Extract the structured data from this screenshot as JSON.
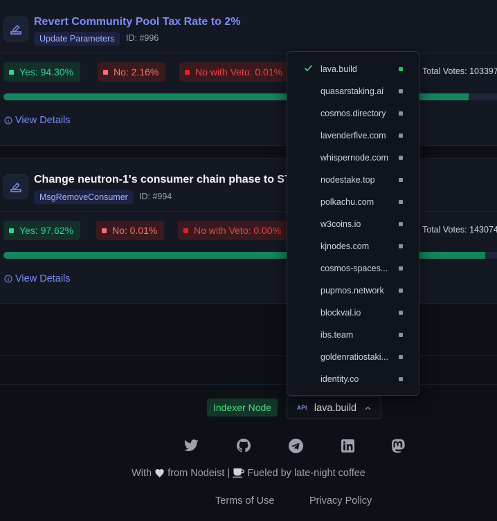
{
  "proposals": [
    {
      "title": "Revert Community Pool Tax Rate to 2%",
      "title_color": "#818cf8",
      "type": "Update Parameters",
      "id": "ID: #996",
      "yes": "Yes: 94.30%",
      "no": "No: 2.16%",
      "veto": "No with Veto: 0.01%",
      "total": "Total Votes: 103397",
      "yes_fraction": 0.943,
      "details": "View Details"
    },
    {
      "title": "Change neutron-1's consumer chain phase to STOP",
      "title_color": "#f3f4f6",
      "type": "MsgRemoveConsumer",
      "id": "ID: #994",
      "yes": "Yes: 97.62%",
      "no": "No: 0.01%",
      "veto": "No with Veto: 0.00%",
      "total": "Total Votes: 143074",
      "yes_fraction": 0.9762,
      "details": "View Details"
    }
  ],
  "api_dropdown": {
    "items": [
      {
        "label": "lava.build",
        "selected": true
      },
      {
        "label": "quasarstaking.ai",
        "selected": false
      },
      {
        "label": "cosmos.directory",
        "selected": false
      },
      {
        "label": "lavenderfive.com",
        "selected": false
      },
      {
        "label": "whispernode.com",
        "selected": false
      },
      {
        "label": "nodestake.top",
        "selected": false
      },
      {
        "label": "polkachu.com",
        "selected": false
      },
      {
        "label": "w3coins.io",
        "selected": false
      },
      {
        "label": "kjnodes.com",
        "selected": false
      },
      {
        "label": "cosmos-spaces...",
        "selected": false
      },
      {
        "label": "pupmos.network",
        "selected": false
      },
      {
        "label": "blockval.io",
        "selected": false
      },
      {
        "label": "ibs.team",
        "selected": false
      },
      {
        "label": "goldenratiostaki...",
        "selected": false
      },
      {
        "label": "identity.co",
        "selected": false
      }
    ]
  },
  "footer": {
    "indexer_badge": "Indexer Node",
    "api_tag": "API",
    "api_value": "lava.build",
    "socials": [
      "twitter-icon",
      "github-icon",
      "telegram-icon",
      "linkedin-icon",
      "mastodon-icon"
    ],
    "made_with_prefix": "With",
    "made_with_suffix": "from Nodeist |",
    "fueled_by": "Fueled by late-night coffee",
    "terms": "Terms of Use",
    "privacy": "Privacy Policy"
  },
  "colors": {
    "accent": "#818cf8",
    "yes": "#34d399",
    "no": "#f87171",
    "veto": "#dc2626",
    "bar": "#16855d",
    "indexer": "#4ade80"
  }
}
